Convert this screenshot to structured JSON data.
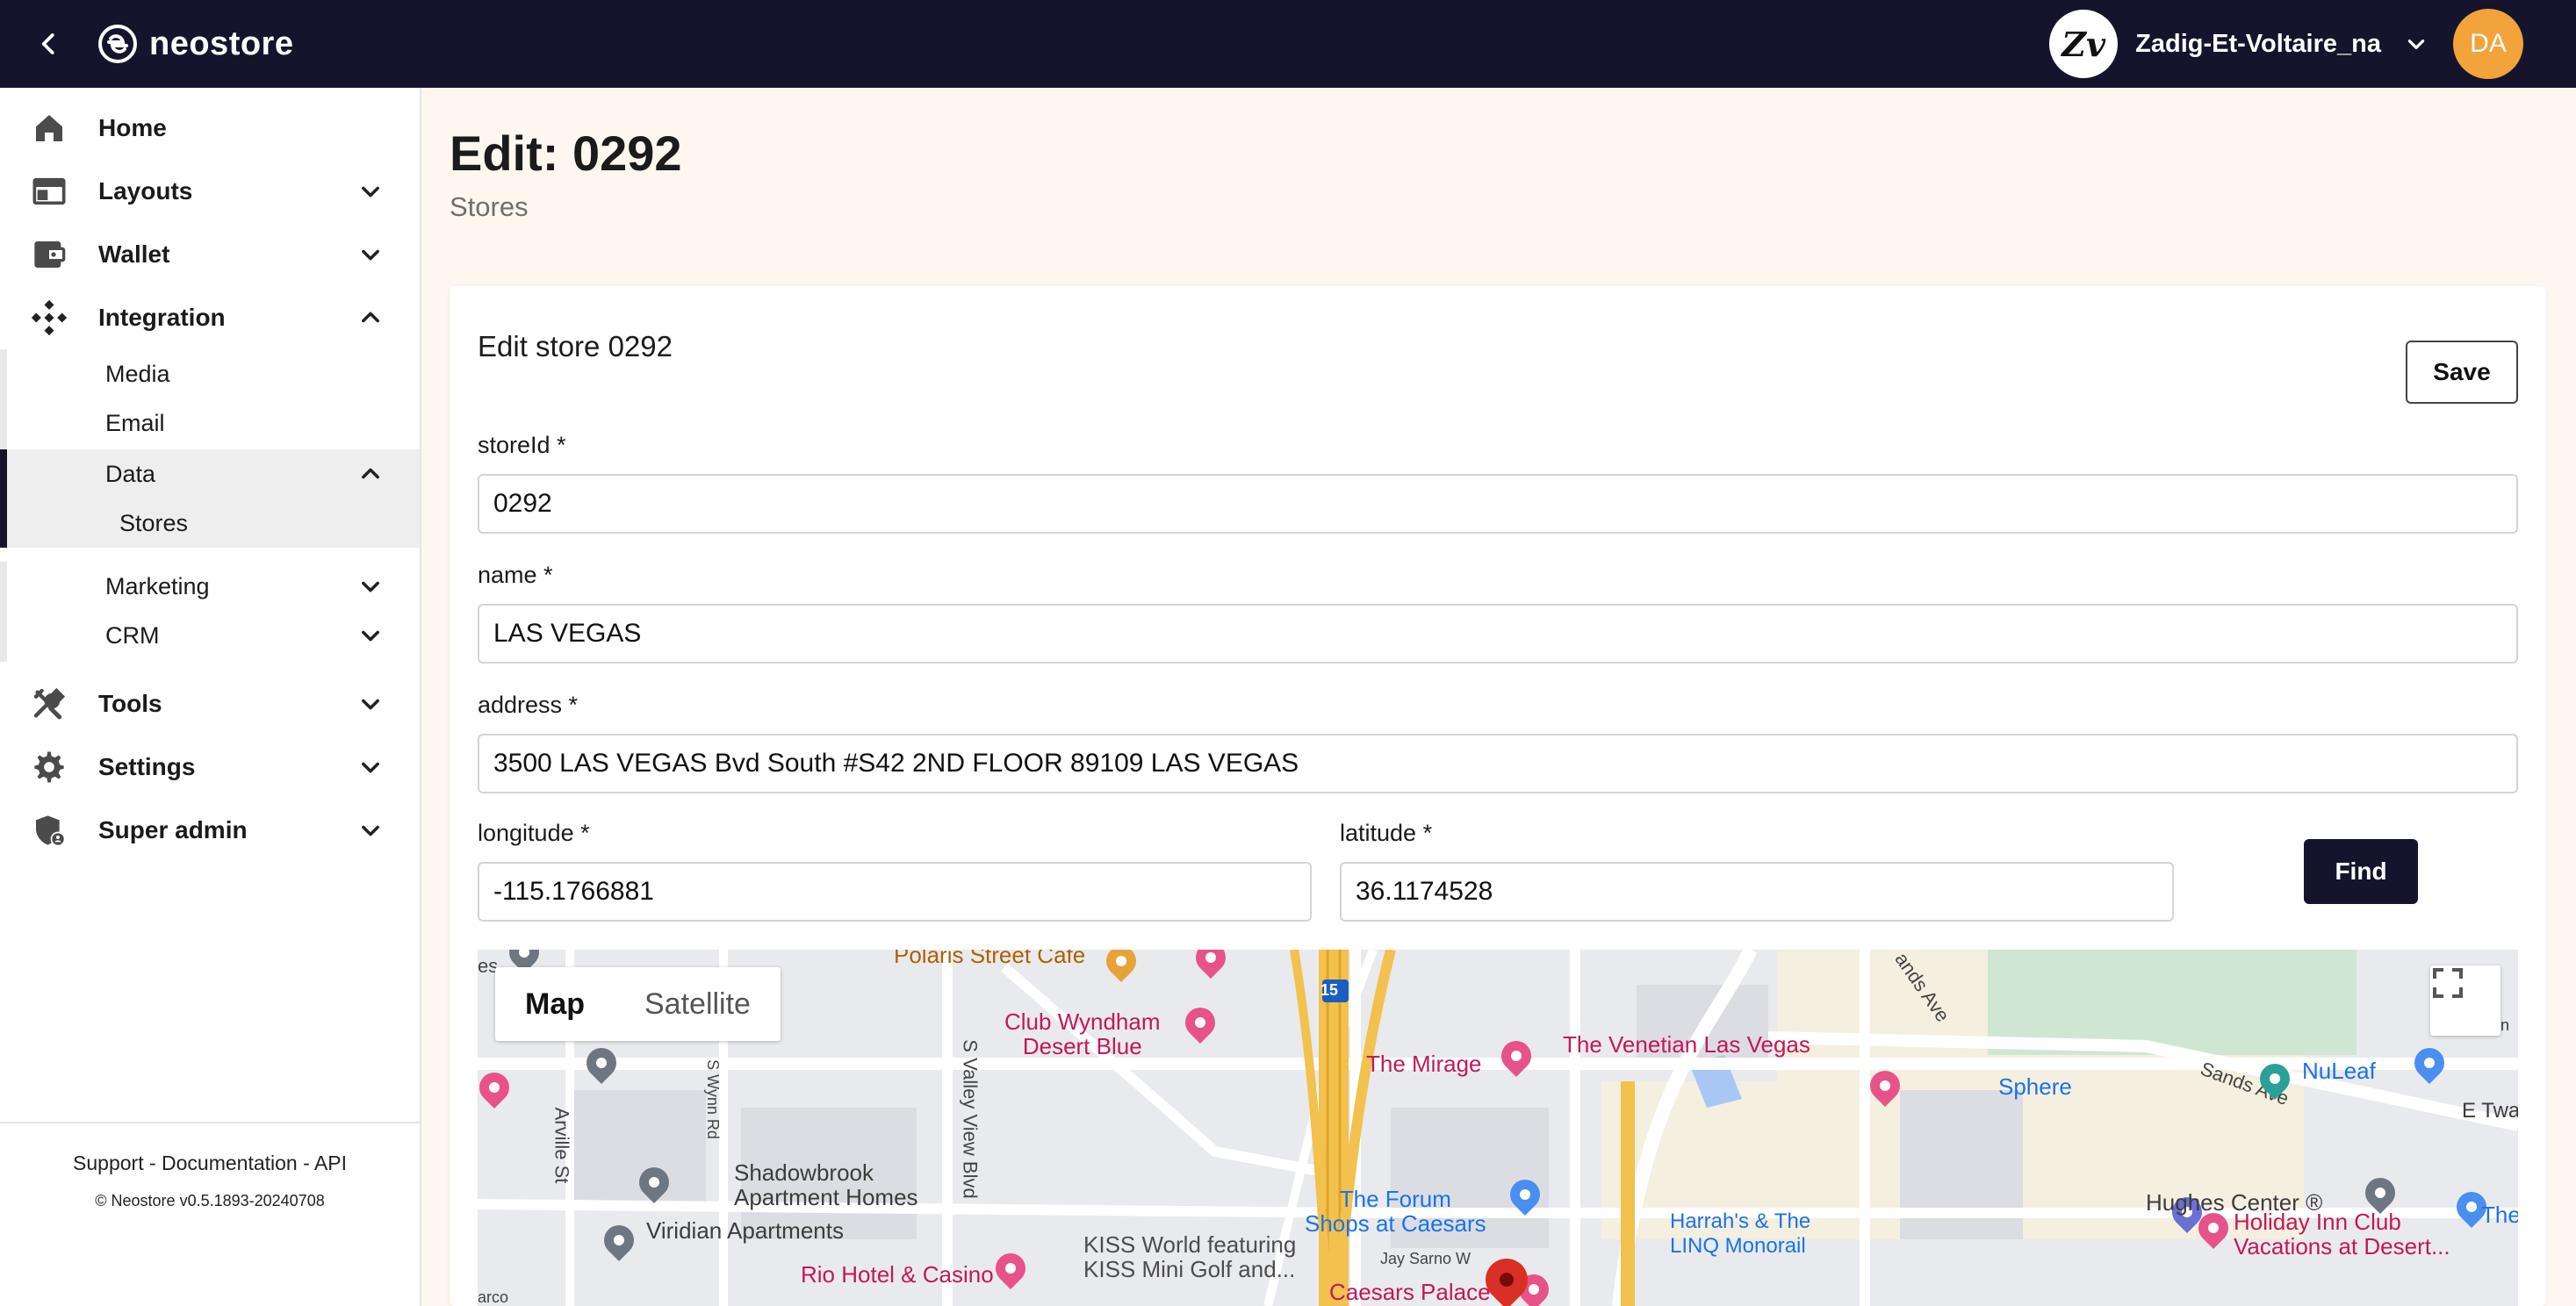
{
  "topbar": {
    "app_name": "neostore",
    "brand_initials": "Zv",
    "brand_name": "Zadig-Et-Voltaire_na",
    "user_initials": "DA"
  },
  "sidebar": {
    "items": [
      {
        "label": "Home",
        "icon": "home-icon"
      },
      {
        "label": "Layouts",
        "icon": "layout-icon"
      },
      {
        "label": "Wallet",
        "icon": "wallet-icon"
      },
      {
        "label": "Integration",
        "icon": "integration-icon"
      },
      {
        "label": "Tools",
        "icon": "tools-icon"
      },
      {
        "label": "Settings",
        "icon": "gear-icon"
      },
      {
        "label": "Super admin",
        "icon": "shield-icon"
      }
    ],
    "integration_children": [
      "Media",
      "Email",
      "Data",
      "Marketing",
      "CRM"
    ],
    "data_children": [
      "Stores"
    ],
    "footer_links": "Support - Documentation - API",
    "footer_version": "© Neostore v0.5.1893-20240708"
  },
  "page": {
    "title": "Edit: 0292",
    "subtitle": "Stores"
  },
  "form": {
    "card_title": "Edit store 0292",
    "save_label": "Save",
    "find_label": "Find",
    "fields": {
      "storeId": {
        "label": "storeId *",
        "value": "0292"
      },
      "name": {
        "label": "name *",
        "value": "LAS VEGAS"
      },
      "address": {
        "label": "address *",
        "value": "3500 LAS VEGAS Bvd South #S42 2ND FLOOR 89109 LAS VEGAS"
      },
      "longitude": {
        "label": "longitude *",
        "value": "-115.1766881"
      },
      "latitude": {
        "label": "latitude *",
        "value": "36.1174528"
      }
    }
  },
  "map": {
    "type_options": [
      "Map",
      "Satellite"
    ],
    "selected_type": "Map",
    "labels": {
      "polaris": "Polaris Street Cafe",
      "club_wyndham": "Club Wyndham\nDesert Blue",
      "mirage": "The Mirage",
      "venetian": "The Venetian Las Vegas",
      "sphere": "Sphere",
      "nuleaf": "NuLeaf",
      "shadowbrook": "Shadowbrook\nApartment Homes",
      "viridian": "Viridian Apartments",
      "rio": "Rio Hotel & Casino",
      "kiss": "KISS World featuring\nKISS Mini Golf and...",
      "forum": "The Forum\nShops at Caesars",
      "harrahs": "Harrah's & The\nLINQ Monorail",
      "hughes": "Hughes Center ®",
      "holiday_inn": "Holiday Inn Club\nVacations at Desert...",
      "the_col": "The Col",
      "caesars": "Caesars Palace",
      "e_twa": "E Twa",
      "eln": "Eln"
    },
    "roads": {
      "arville": "Arville St",
      "wynn": "S Wynn Rd",
      "valley_view": "S Valley View Blvd",
      "sands_ave": "Sands Ave",
      "sands_ave_top": "ands Ave",
      "jay_sarno": "Jay Sarno W",
      "i15": "15",
      "es": "es",
      "arco": "arco"
    }
  }
}
